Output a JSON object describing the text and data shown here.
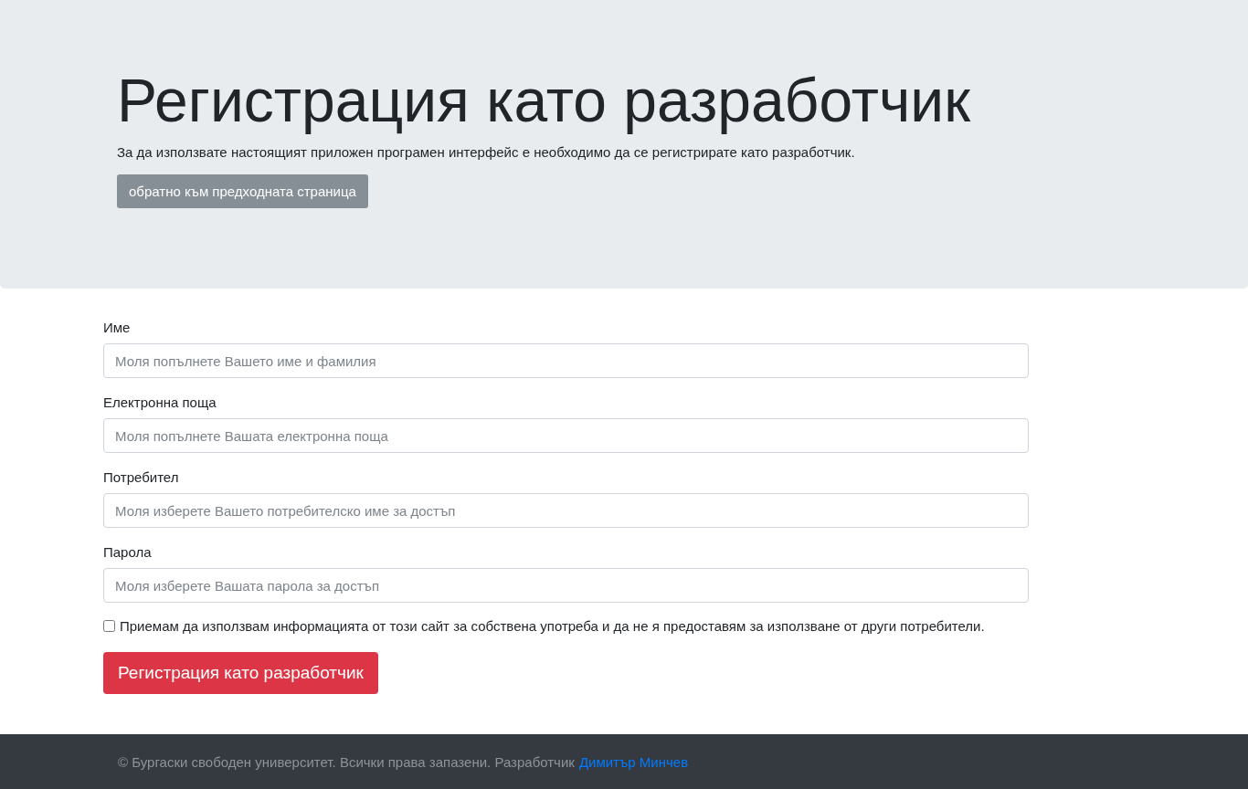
{
  "header": {
    "title": "Регистрация като разработчик",
    "lead": "За да използвате настоящият приложен програмен интерфейс е необходимо да се регистрирате като разработчик.",
    "back_button": "обратно към предходната страница"
  },
  "form": {
    "fields": [
      {
        "label": "Име",
        "placeholder": "Моля попълнете Вашето име и фамилия"
      },
      {
        "label": "Електронна поща",
        "placeholder": "Моля попълнете Вашата електронна поща"
      },
      {
        "label": "Потребител",
        "placeholder": "Моля изберете Вашето потребителско име за достъп"
      },
      {
        "label": "Парола",
        "placeholder": "Моля изберете Вашата парола за достъп"
      }
    ],
    "agreement": {
      "label": "Приемам да използвам информацията от този сайт за собствена употреба и да не я предоставям за използване от други потребители.",
      "checked": false
    },
    "submit": "Регистрация като разработчик"
  },
  "footer": {
    "text": "© Бургаски свободен университет. Всички права запазени. Разработчик",
    "link": "Димитър Минчев"
  }
}
